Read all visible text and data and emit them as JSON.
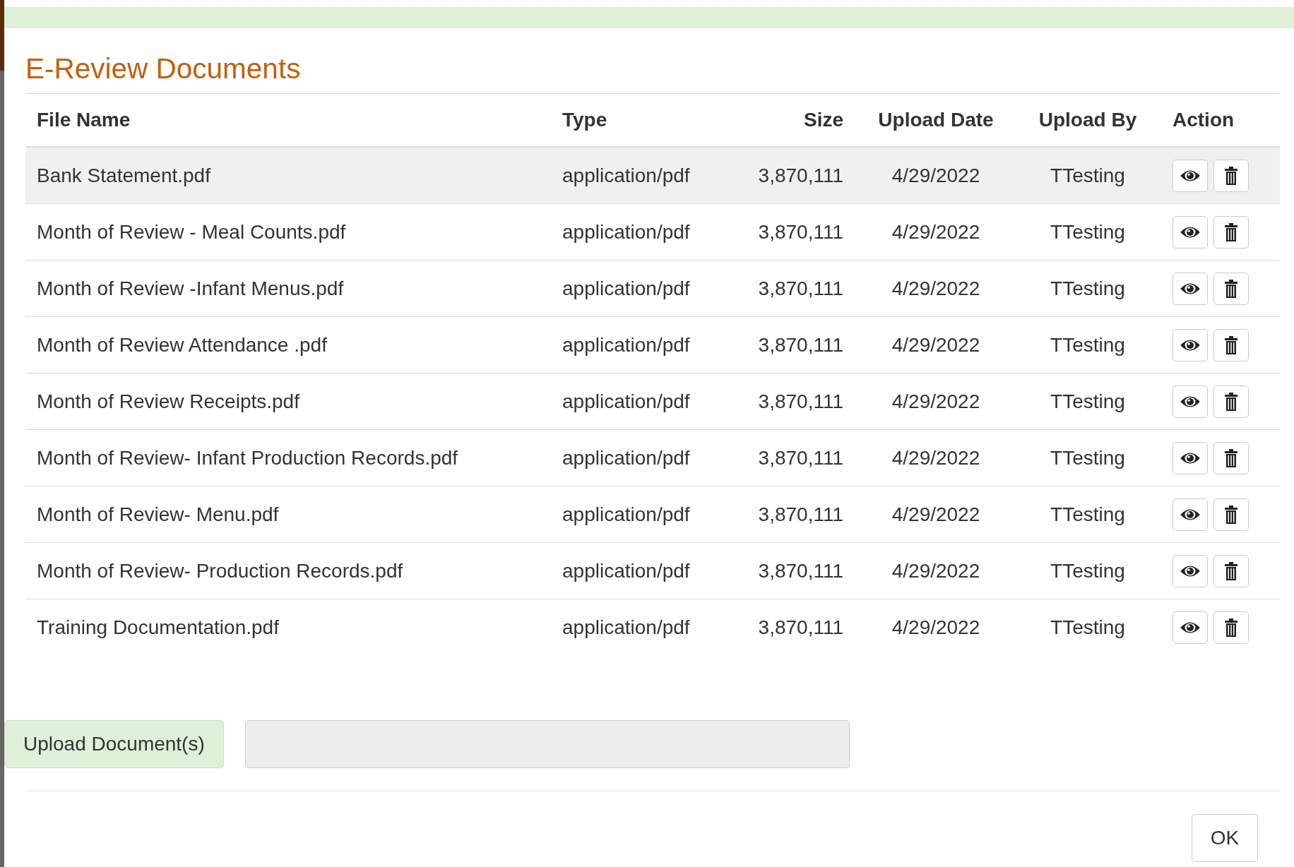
{
  "title": "E-Review Documents",
  "table": {
    "columns": [
      "File Name",
      "Type",
      "Size",
      "Upload Date",
      "Upload By",
      "Action"
    ],
    "rows": [
      {
        "file_name": "Bank Statement.pdf",
        "type": "application/pdf",
        "size": "3,870,111",
        "upload_date": "4/29/2022",
        "upload_by": "TTesting",
        "selected": true
      },
      {
        "file_name": "Month of Review - Meal Counts.pdf",
        "type": "application/pdf",
        "size": "3,870,111",
        "upload_date": "4/29/2022",
        "upload_by": "TTesting",
        "selected": false
      },
      {
        "file_name": "Month of Review -Infant Menus.pdf",
        "type": "application/pdf",
        "size": "3,870,111",
        "upload_date": "4/29/2022",
        "upload_by": "TTesting",
        "selected": false
      },
      {
        "file_name": "Month of Review Attendance .pdf",
        "type": "application/pdf",
        "size": "3,870,111",
        "upload_date": "4/29/2022",
        "upload_by": "TTesting",
        "selected": false
      },
      {
        "file_name": "Month of Review Receipts.pdf",
        "type": "application/pdf",
        "size": "3,870,111",
        "upload_date": "4/29/2022",
        "upload_by": "TTesting",
        "selected": false
      },
      {
        "file_name": "Month of Review- Infant Production Records.pdf",
        "type": "application/pdf",
        "size": "3,870,111",
        "upload_date": "4/29/2022",
        "upload_by": "TTesting",
        "selected": false
      },
      {
        "file_name": "Month of Review- Menu.pdf",
        "type": "application/pdf",
        "size": "3,870,111",
        "upload_date": "4/29/2022",
        "upload_by": "TTesting",
        "selected": false
      },
      {
        "file_name": "Month of Review- Production Records.pdf",
        "type": "application/pdf",
        "size": "3,870,111",
        "upload_date": "4/29/2022",
        "upload_by": "TTesting",
        "selected": false
      },
      {
        "file_name": "Training Documentation.pdf",
        "type": "application/pdf",
        "size": "3,870,111",
        "upload_date": "4/29/2022",
        "upload_by": "TTesting",
        "selected": false
      }
    ]
  },
  "upload_button": "Upload Document(s)",
  "ok_button": "OK"
}
